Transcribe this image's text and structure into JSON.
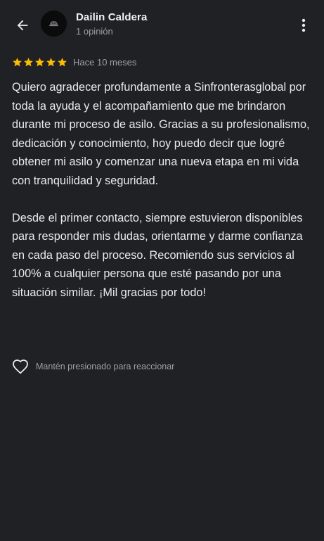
{
  "header": {
    "back_icon": "arrow-back-icon",
    "avatar_icon": "user-avatar",
    "reviewer_name": "Dailin Caldera",
    "reviewer_meta": "1 opinión",
    "more_icon": "more-vertical-icon"
  },
  "review": {
    "rating": 5,
    "rating_max": 5,
    "star_color": "#fbbc04",
    "date": "Hace 10 meses",
    "paragraphs": [
      "Quiero agradecer profundamente a Sinfronterasglobal por toda la ayuda y el acompañamiento que me brindaron durante mi proceso de asilo. Gracias a su profesionalismo, dedicación y conocimiento, hoy puedo decir que logré obtener mi asilo y comenzar una nueva etapa en mi vida con tranquilidad y seguridad.",
      "Desde el primer contacto, siempre estuvieron disponibles para responder mis dudas, orientarme y darme confianza en cada paso del proceso. Recomiendo sus servicios al 100% a cualquier persona que esté pasando por una situación similar. ¡Mil gracias por todo!"
    ]
  },
  "reaction": {
    "icon": "heart-outline-icon",
    "label": "Mantén presionado para reaccionar"
  },
  "colors": {
    "background": "#202124",
    "text_primary": "#e8eaed",
    "text_secondary": "#9aa0a6"
  }
}
